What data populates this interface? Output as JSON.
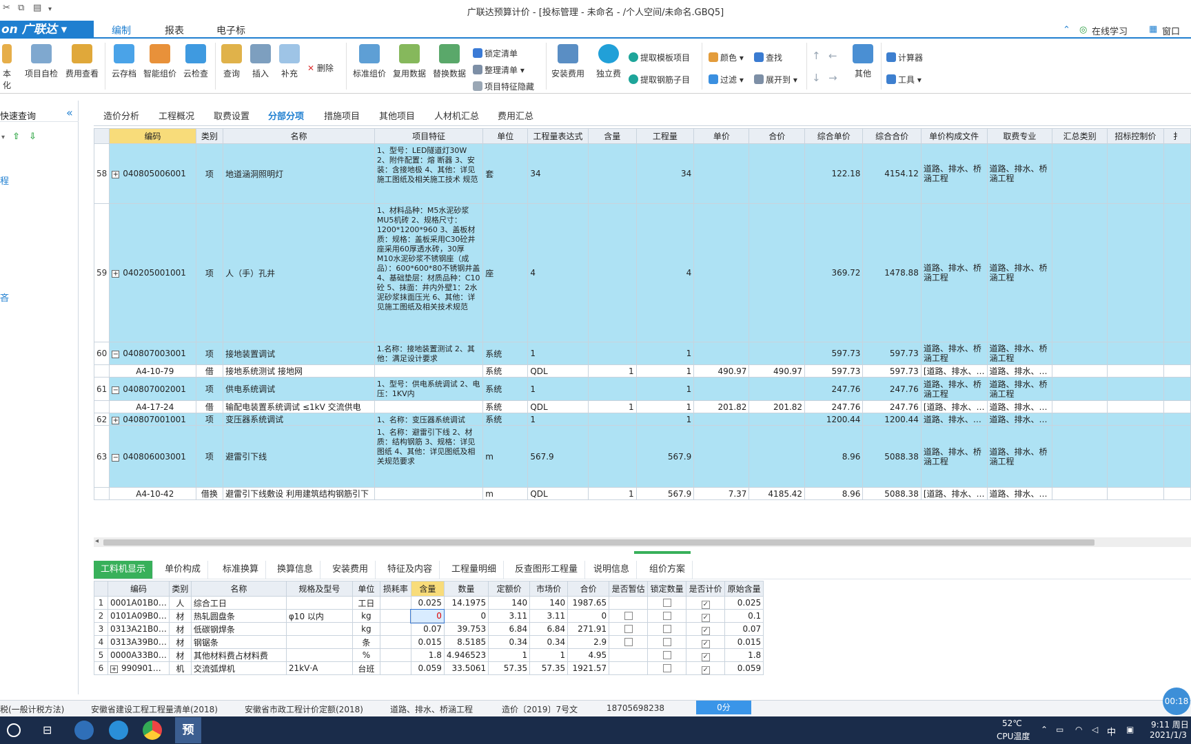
{
  "window": {
    "title": "广联达预算计价 - [投标管理 - 未命名 - /个人空间/未命名.GBQ5]",
    "logo": "on 广联达 ▾"
  },
  "ribbon_tabs": [
    "编制",
    "报表",
    "电子标"
  ],
  "top_right": {
    "learn": "在线学习",
    "window": "窗口"
  },
  "ribbon": {
    "labels": {
      "b0": "本化",
      "b1": "项目自检",
      "b2": "费用查看",
      "b3": "云存档",
      "b4": "智能组价",
      "b5": "云检查",
      "b6": "查询",
      "b7": "插入",
      "b8": "补充",
      "b9": "删除",
      "b10": "标准组价",
      "b11": "复用数据",
      "b12": "替换数据",
      "b13": "锁定清单",
      "b14": "整理清单",
      "b15": "项目特征隐藏",
      "b16": "安装费用",
      "b17": "独立费",
      "b18": "提取模板项目",
      "b19": "提取钢筋子目",
      "b20": "颜色",
      "b21": "查找",
      "b22": "过滤",
      "b23": "展开到",
      "b24": "其他",
      "b25": "计算器",
      "b26": "工具"
    }
  },
  "left_pane": {
    "title": "快速查询",
    "item1": "程",
    "item2": "吝"
  },
  "sub_tabs": [
    "造价分析",
    "工程概况",
    "取费设置",
    "分部分项",
    "措施项目",
    "其他项目",
    "人材机汇总",
    "费用汇总"
  ],
  "grid": {
    "headers": [
      "编码",
      "类别",
      "名称",
      "项目特征",
      "单位",
      "工程量表达式",
      "含量",
      "工程量",
      "单价",
      "合价",
      "综合单价",
      "综合合价",
      "单价构成文件",
      "取费专业",
      "汇总类别",
      "招标控制价",
      "扌"
    ],
    "rows": [
      {
        "rn": "58",
        "code": "040805006001",
        "type": "项",
        "name": "地道涵洞照明灯",
        "feat": "1、型号：LED隧道灯30W 2、附件配置：熔 断器 3、安装：含接地极 4、其他：详见施工图纸及相关施工技术 规范",
        "unit": "套",
        "expr": "34",
        "qty_ratio": "",
        "qty": "34",
        "price": "",
        "total": "",
        "cprice": "122.18",
        "ctotal": "4154.12",
        "file": "道路、排水、桥涵工程",
        "fee": "道路、排水、桥涵工程"
      },
      {
        "rn": "59",
        "code": "040205001001",
        "type": "项",
        "name": "人（手）孔井",
        "feat": "1、材料品种：M5水泥砂浆MU5机砖 2、规格尺寸：1200*1200*960 3、盖板材质：规格：盖板采用C30砼井座采用60厚透水砖，30厚M10水泥砂浆不锈钢座（成品）：600*600*80不锈钢井盖 4、基础垫层：材质品种：C10砼 5、抹面：井内外壁1：2水泥砂浆抹面压光 6、其他：详见施工图纸及相关技术规范",
        "unit": "座",
        "expr": "4",
        "qty_ratio": "",
        "qty": "4",
        "price": "",
        "total": "",
        "cprice": "369.72",
        "ctotal": "1478.88",
        "file": "道路、排水、桥涵工程",
        "fee": "道路、排水、桥涵工程"
      },
      {
        "rn": "60",
        "code": "040807003001",
        "type": "项",
        "name": "接地装置调试",
        "feat": "1.名称：接地装置测试 2、其他：满足设计要求",
        "unit": "系统",
        "expr": "1",
        "qty_ratio": "",
        "qty": "1",
        "price": "",
        "total": "",
        "cprice": "597.73",
        "ctotal": "597.73",
        "file": "道路、排水、桥涵工程",
        "fee": "道路、排水、桥涵工程"
      },
      {
        "rn": "",
        "code": "A4-10-79",
        "type": "借",
        "name": "接地系统测试 接地网",
        "feat": "",
        "unit": "系统",
        "expr": "QDL",
        "qty_ratio": "1",
        "qty": "1",
        "price": "490.97",
        "total": "490.97",
        "cprice": "597.73",
        "ctotal": "597.73",
        "file": "[道路、排水、…",
        "fee": "道路、排水、…"
      },
      {
        "rn": "61",
        "code": "040807002001",
        "type": "项",
        "name": "供电系统调试",
        "feat": "1、型号：供电系统调试 2、电压：1KV内",
        "unit": "系统",
        "expr": "1",
        "qty_ratio": "",
        "qty": "1",
        "price": "",
        "total": "",
        "cprice": "247.76",
        "ctotal": "247.76",
        "file": "道路、排水、桥涵工程",
        "fee": "道路、排水、桥涵工程"
      },
      {
        "rn": "",
        "code": "A4-17-24",
        "type": "借",
        "name": "输配电装置系统调试 ≤1kV 交流供电",
        "feat": "",
        "unit": "系统",
        "expr": "QDL",
        "qty_ratio": "1",
        "qty": "1",
        "price": "201.82",
        "total": "201.82",
        "cprice": "247.76",
        "ctotal": "247.76",
        "file": "[道路、排水、…",
        "fee": "道路、排水、…"
      },
      {
        "rn": "62",
        "code": "040807001001",
        "type": "项",
        "name": "变压器系统调试",
        "feat": "1、名称：变压器系统调试",
        "unit": "系统",
        "expr": "1",
        "qty_ratio": "",
        "qty": "1",
        "price": "",
        "total": "",
        "cprice": "1200.44",
        "ctotal": "1200.44",
        "file": "道路、排水、…",
        "fee": "道路、排水、…"
      },
      {
        "rn": "63",
        "code": "040806003001",
        "type": "项",
        "name": "避雷引下线",
        "feat": "1、名称：避雷引下线 2、材质：结构钢筋 3、规格：详见图纸 4、其他：详见图纸及相关规范要求",
        "unit": "m",
        "expr": "567.9",
        "qty_ratio": "",
        "qty": "567.9",
        "price": "",
        "total": "",
        "cprice": "8.96",
        "ctotal": "5088.38",
        "file": "道路、排水、桥涵工程",
        "fee": "道路、排水、桥涵工程"
      },
      {
        "rn": "",
        "code": "A4-10-42",
        "type": "借换",
        "name": "避雷引下线敷设 利用建筑结构钢筋引下",
        "feat": "",
        "unit": "m",
        "expr": "QDL",
        "qty_ratio": "1",
        "qty": "567.9",
        "price": "7.37",
        "total": "4185.42",
        "cprice": "8.96",
        "ctotal": "5088.38",
        "file": "[道路、排水、…",
        "fee": "道路、排水、…"
      }
    ]
  },
  "bottom_tabs": [
    "工料机显示",
    "单价构成",
    "标准换算",
    "换算信息",
    "安装费用",
    "特征及内容",
    "工程量明细",
    "反查图形工程量",
    "说明信息",
    "组价方案"
  ],
  "bottom_grid": {
    "headers": [
      "编码",
      "类别",
      "名称",
      "规格及型号",
      "单位",
      "损耗率",
      "含量",
      "数量",
      "定额价",
      "市场价",
      "合价",
      "是否暂估",
      "锁定数量",
      "是否计价",
      "原始含量"
    ],
    "rows": [
      {
        "n": "1",
        "code": "0001A01B0…",
        "type": "人",
        "name": "综合工日",
        "spec": "",
        "unit": "工日",
        "loss": "",
        "ratio": "0.025",
        "qty": "14.1975",
        "dprice": "140",
        "mprice": "140",
        "total": "1987.65",
        "est": "",
        "lock": "box",
        "calc": "check",
        "orig": "0.025"
      },
      {
        "n": "2",
        "code": "0101A09B0…",
        "type": "材",
        "name": "热轧圆盘条",
        "spec": "φ10 以内",
        "unit": "kg",
        "loss": "",
        "ratio": "0",
        "qty": "0",
        "dprice": "3.11",
        "mprice": "3.11",
        "total": "0",
        "est": "box",
        "lock": "box",
        "calc": "check",
        "orig": "0.1"
      },
      {
        "n": "3",
        "code": "0313A21B0…",
        "type": "材",
        "name": "低碳钢焊条",
        "spec": "",
        "unit": "kg",
        "loss": "",
        "ratio": "0.07",
        "qty": "39.753",
        "dprice": "6.84",
        "mprice": "6.84",
        "total": "271.91",
        "est": "box",
        "lock": "box",
        "calc": "check",
        "orig": "0.07"
      },
      {
        "n": "4",
        "code": "0313A39B0…",
        "type": "材",
        "name": "钢锯条",
        "spec": "",
        "unit": "条",
        "loss": "",
        "ratio": "0.015",
        "qty": "8.5185",
        "dprice": "0.34",
        "mprice": "0.34",
        "total": "2.9",
        "est": "box",
        "lock": "box",
        "calc": "check",
        "orig": "0.015"
      },
      {
        "n": "5",
        "code": "0000A33B0…",
        "type": "材",
        "name": "其他材料费占材料费",
        "spec": "",
        "unit": "%",
        "loss": "",
        "ratio": "1.8",
        "qty": "4.946523",
        "dprice": "1",
        "mprice": "1",
        "total": "4.95",
        "est": "",
        "lock": "box",
        "calc": "check",
        "orig": "1.8"
      },
      {
        "n": "6",
        "code": "990901…",
        "type": "机",
        "name": "交流弧焊机",
        "spec": "21kV·A",
        "unit": "台班",
        "loss": "",
        "ratio": "0.059",
        "qty": "33.5061",
        "dprice": "57.35",
        "mprice": "57.35",
        "total": "1921.57",
        "est": "",
        "lock": "box",
        "calc": "check",
        "orig": "0.059"
      }
    ]
  },
  "status_bar": {
    "s1": "税(一般计税方法)",
    "s2": "安徽省建设工程工程量清单(2018)",
    "s3": "安徽省市政工程计价定额(2018)",
    "s4": "道路、排水、桥涵工程",
    "s5": "造价〔2019〕7号文",
    "s6": "18705698238",
    "progress": "0分"
  },
  "timer": "00:18",
  "taskbar": {
    "temp": "52℃",
    "temp_label": "CPU温度",
    "ime": "中",
    "time": "9:11 周日",
    "date": "2021/1/3"
  },
  "colors": {
    "accent": "#1f7fd0",
    "row_blue": "#aee2f4",
    "green_tab": "#38b05a"
  }
}
